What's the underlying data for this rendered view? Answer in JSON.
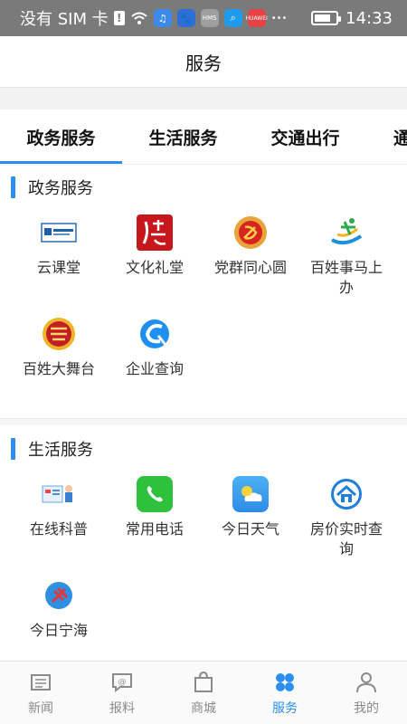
{
  "status_bar": {
    "sim_text": "没有 SIM 卡",
    "time": "14:33",
    "mms_badge": "HMS",
    "huawei_badge": "HUAWEI",
    "dots": "•••",
    "battery_level": 0.78
  },
  "header": {
    "title": "服务"
  },
  "tabs": [
    {
      "label": "政务服务"
    },
    {
      "label": "生活服务"
    },
    {
      "label": "交通出行"
    },
    {
      "label": "通"
    }
  ],
  "sections": [
    {
      "title": "政务服务",
      "items": [
        {
          "label": "云课堂",
          "icon": "cloud-classroom-icon"
        },
        {
          "label": "文化礼堂",
          "icon": "culture-hall-icon"
        },
        {
          "label": "党群同心圆",
          "icon": "party-emblem-icon"
        },
        {
          "label": "百姓事马上办",
          "icon": "quick-service-icon"
        },
        {
          "label": "百姓大舞台",
          "icon": "stage-icon"
        },
        {
          "label": "企业查询",
          "icon": "enterprise-query-icon"
        }
      ]
    },
    {
      "title": "生活服务",
      "items": [
        {
          "label": "在线科普",
          "icon": "science-icon"
        },
        {
          "label": "常用电话",
          "icon": "phone-icon"
        },
        {
          "label": "今日天气",
          "icon": "weather-icon"
        },
        {
          "label": "房价实时查询",
          "icon": "house-icon"
        },
        {
          "label": "今日宁海",
          "icon": "ninghai-icon"
        }
      ]
    }
  ],
  "bottom_nav": [
    {
      "label": "新闻",
      "icon": "news-icon"
    },
    {
      "label": "报料",
      "icon": "report-icon"
    },
    {
      "label": "商城",
      "icon": "shop-icon"
    },
    {
      "label": "服务",
      "icon": "service-icon"
    },
    {
      "label": "我的",
      "icon": "profile-icon"
    }
  ],
  "colors": {
    "accent": "#2a8ff0",
    "status_bar": "#7a7a7a"
  }
}
